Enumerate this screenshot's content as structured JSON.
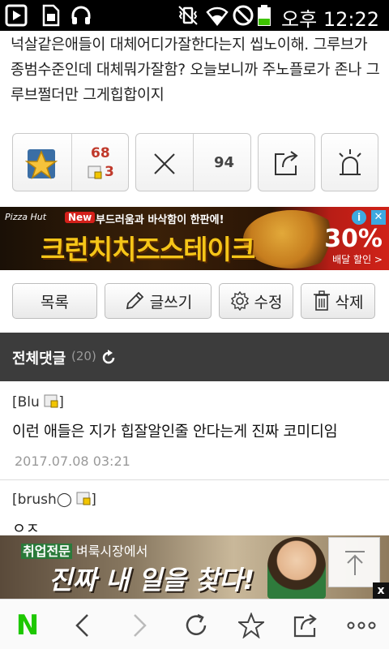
{
  "status_bar": {
    "time": "오후 12:22",
    "icons": [
      "play-store-icon",
      "sim-card-icon",
      "headset-icon",
      "vibrate-icon",
      "wifi-icon",
      "no-signal-icon",
      "battery-low-icon"
    ]
  },
  "post": {
    "body": "넉살같은애들이 대체어디가잘한다는지 씹노이해. 그루브가 종범수준인데 대체뭐가잘함? 오늘보니까 주노플로가 존나 그루브쩔더만 그게힙합이지"
  },
  "actions": {
    "recommend_count": "68",
    "recommend_sub_count": "3",
    "disapprove_count": "94",
    "icons": [
      "star-icon",
      "x-icon",
      "share-icon",
      "siren-icon"
    ]
  },
  "ad_top": {
    "brand": "Pizza Hut",
    "new_badge": "New",
    "subtitle": "부드러움과 바삭함이 한판에!",
    "headline": "크런치치즈스테이크",
    "discount": "30%",
    "discount_label": "배달 할인 >"
  },
  "buttons": {
    "list": "목록",
    "write": "글쓰기",
    "edit": "수정",
    "delete": "삭제"
  },
  "comments_header": {
    "label": "전체댓글",
    "count": "(20)"
  },
  "comments": [
    {
      "author": "[Blu",
      "author_end": "]",
      "text": "이런 애들은 지가 힙잘알인줄 안다는게 진짜 코미디임",
      "date": "2017.07.08 03:21"
    },
    {
      "author": "[brush◯",
      "author_end": "]",
      "text": "ㅇㅈ"
    }
  ],
  "ad_bottom": {
    "tag": "취업전문",
    "subtitle": "벼룩시장에서",
    "headline": "진짜 내 일을 찾다!",
    "close_label": "x"
  },
  "navbar": {
    "icons": [
      "naver-n-icon",
      "back-icon",
      "forward-icon",
      "refresh-icon",
      "bookmark-star-icon",
      "share-icon",
      "more-icon"
    ],
    "naver_label": "N"
  },
  "colors": {
    "status_bar": "#000000",
    "comments_header": "#3c3c3c",
    "accent_red": "#c0392b",
    "naver_green": "#1ec800"
  }
}
